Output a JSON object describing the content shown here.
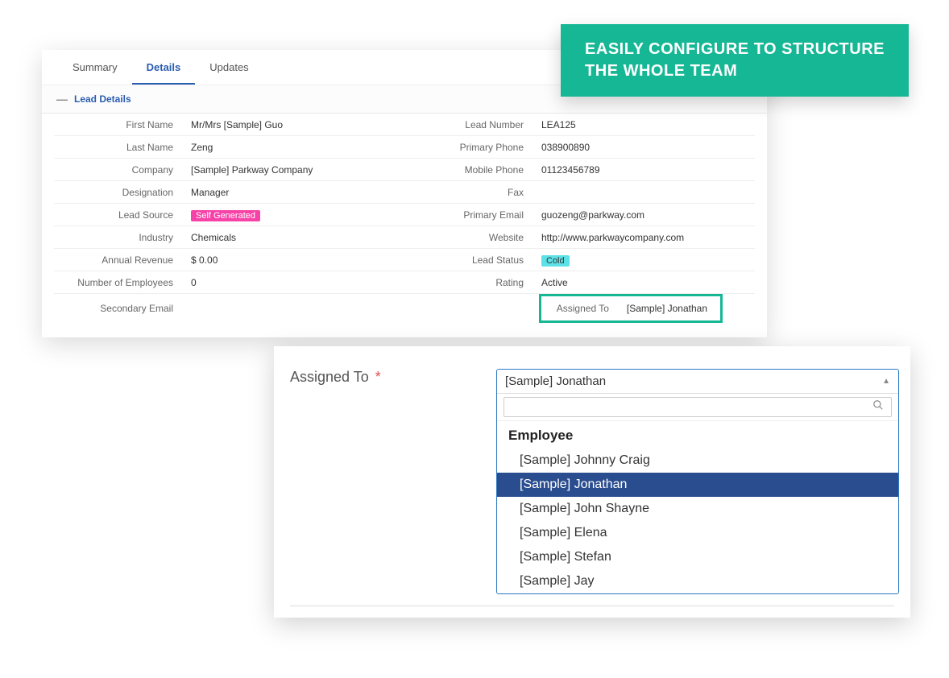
{
  "banner": {
    "line1": "EASILY CONFIGURE TO STRUCTURE",
    "line2": "THE WHOLE TEAM"
  },
  "tabs": {
    "summary": "Summary",
    "details": "Details",
    "updates": "Updates"
  },
  "section": {
    "title": "Lead Details"
  },
  "fields": {
    "left": [
      {
        "label": "First Name",
        "value": "Mr/Mrs [Sample] Guo"
      },
      {
        "label": "Last Name",
        "value": "Zeng"
      },
      {
        "label": "Company",
        "value": "[Sample] Parkway Company"
      },
      {
        "label": "Designation",
        "value": "Manager"
      },
      {
        "label": "Lead Source",
        "value": "Self Generated",
        "pill": "pink"
      },
      {
        "label": "Industry",
        "value": "Chemicals"
      },
      {
        "label": "Annual Revenue",
        "value": "$ 0.00"
      },
      {
        "label": "Number of Employees",
        "value": "0"
      },
      {
        "label": "Secondary Email",
        "value": ""
      }
    ],
    "right": [
      {
        "label": "Lead Number",
        "value": "LEA125"
      },
      {
        "label": "Primary Phone",
        "value": "038900890"
      },
      {
        "label": "Mobile Phone",
        "value": "01123456789"
      },
      {
        "label": "Fax",
        "value": ""
      },
      {
        "label": "Primary Email",
        "value": "guozeng@parkway.com"
      },
      {
        "label": "Website",
        "value": "http://www.parkwaycompany.com"
      },
      {
        "label": "Lead Status",
        "value": "Cold",
        "pill": "cyan"
      },
      {
        "label": "Rating",
        "value": "Active"
      },
      {
        "label": "Assigned To",
        "value": "[Sample] Jonathan",
        "highlight": true
      }
    ]
  },
  "dropdown": {
    "label": "Assigned To",
    "required": "*",
    "selected": "[Sample] Jonathan",
    "search_placeholder": "",
    "group": "Employee",
    "options": [
      "[Sample] Johnny Craig",
      "[Sample] Jonathan",
      "[Sample] John Shayne",
      "[Sample] Elena",
      "[Sample] Stefan",
      "[Sample] Jay"
    ],
    "selected_index": 1
  }
}
